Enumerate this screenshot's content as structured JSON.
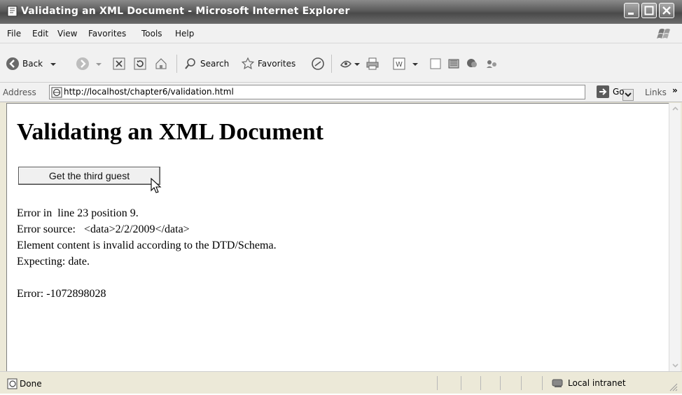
{
  "window": {
    "title": "Validating an XML Document - Microsoft Internet Explorer"
  },
  "menu": {
    "items": [
      "File",
      "Edit",
      "View",
      "Favorites",
      "Tools",
      "Help"
    ]
  },
  "toolbar": {
    "back_label": "Back",
    "search_label": "Search",
    "favorites_label": "Favorites"
  },
  "address": {
    "label": "Address",
    "url": "http://localhost/chapter6/validation.html",
    "go_label": "Go",
    "links_label": "Links",
    "more_label": "»"
  },
  "page": {
    "heading": "Validating an XML Document",
    "button_label": "Get the third guest",
    "error_lines": [
      "Error in  line 23 position 9.",
      "Error source:   <data>2/2/2009</data>",
      "Element content is invalid according to the DTD/Schema.",
      "Expecting: date.",
      "Error: -1072898028"
    ]
  },
  "status": {
    "text": "Done",
    "zone": "Local intranet"
  }
}
